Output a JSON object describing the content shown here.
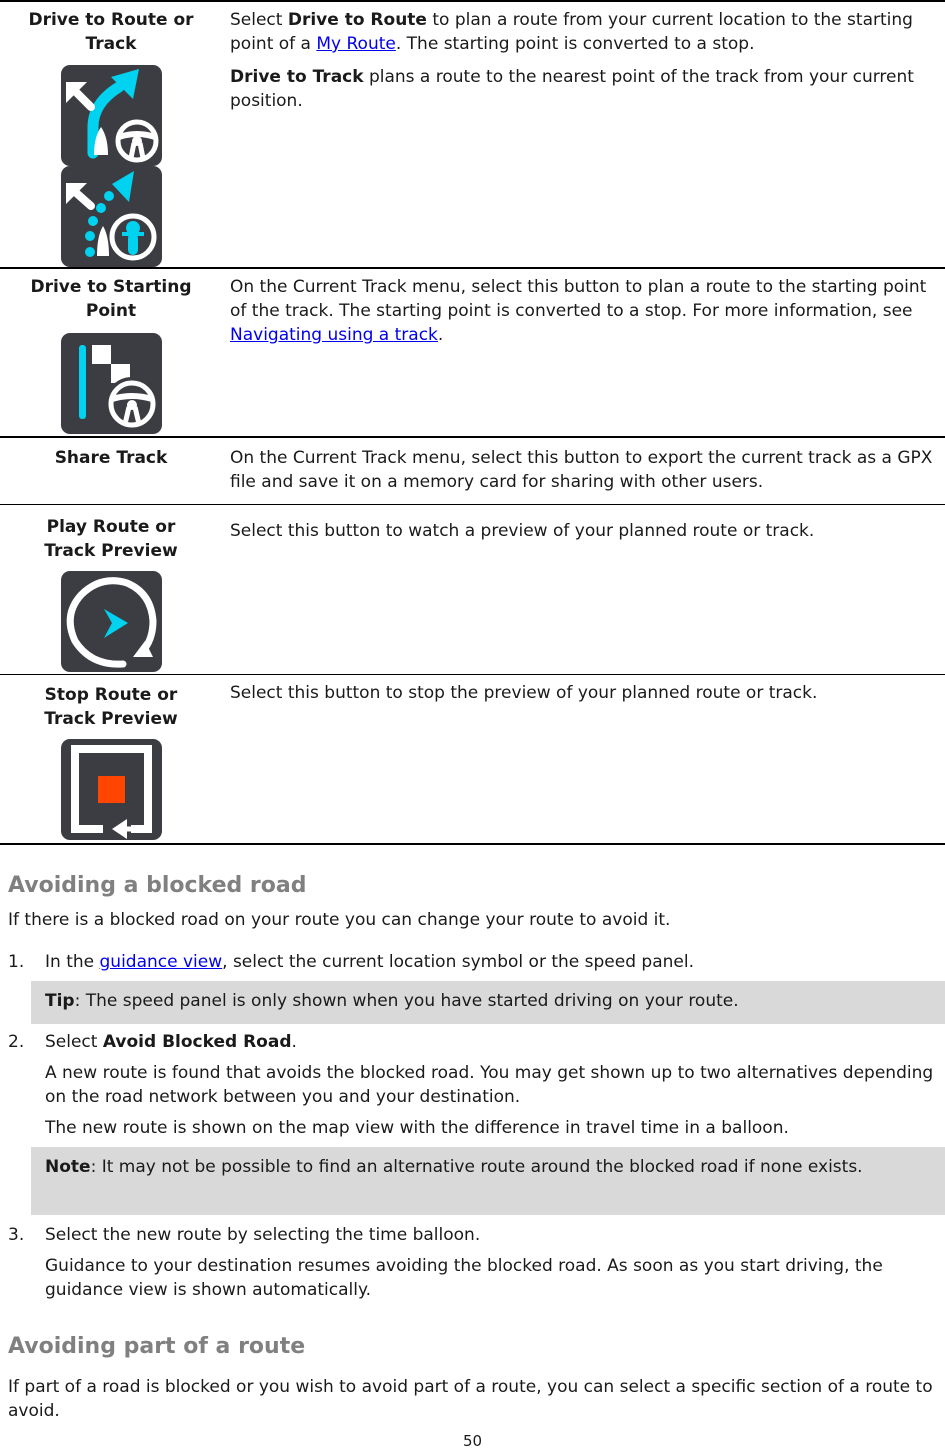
{
  "table": {
    "rows": [
      {
        "term": "Drive to Route or Track",
        "icons": [
          "drive-to-route-icon",
          "drive-to-track-icon"
        ],
        "desc1_pre": "Select ",
        "desc1_bold": "Drive to Route",
        "desc1_mid": " to plan a route from your current location to the starting point of a ",
        "desc1_link": "My Route",
        "desc1_post": ". The starting point is converted to a stop.",
        "desc2_bold": "Drive to Track",
        "desc2_post": " plans a route to the nearest point of the track from your current position."
      },
      {
        "term": "Drive to Starting Point",
        "icons": [
          "drive-to-starting-point-icon"
        ],
        "desc_pre": "On the Current Track menu, select this button to plan a route to the starting point of the track. The starting point is converted to a stop. For more information, see ",
        "desc_link": "Navigating using a track",
        "desc_post": "."
      },
      {
        "term": "Share Track",
        "icons": [],
        "desc": "On the Current Track menu, select this button to export the current track as a GPX file and save it on a memory card for sharing with other users."
      },
      {
        "term": "Play Route or Track Preview",
        "icons": [
          "play-preview-icon"
        ],
        "desc": "Select this button to watch a preview of your planned route or track."
      },
      {
        "term": "Stop Route or Track Preview",
        "icons": [
          "stop-preview-icon"
        ],
        "desc": "Select this button to stop the preview of your planned route or track."
      }
    ]
  },
  "section1": {
    "heading": "Avoiding a blocked road",
    "intro": "If there is a blocked road on your route you can change your route to avoid it.",
    "step1": {
      "num": "1.",
      "pre": "In the ",
      "link": "guidance view",
      "post": ", select the current location symbol or the speed panel."
    },
    "tip": {
      "label": "Tip",
      "text": ": The speed panel is only shown when you have started driving on your route."
    },
    "step2": {
      "num": "2.",
      "pre": "Select ",
      "bold": "Avoid Blocked Road",
      "post": ".",
      "p1": "A new route is found that avoids the blocked road. You may get shown up to two alternatives depending on the road network between you and your destination.",
      "p2": "The new route is shown on the map view with the difference in travel time in a balloon."
    },
    "note": {
      "label": "Note",
      "text": ": It may not be possible to find an alternative route around the blocked road if none exists."
    },
    "step3": {
      "num": "3.",
      "text": "Select the new route by selecting the time balloon.",
      "p1": "Guidance to your destination resumes avoiding the blocked road. As soon as you start driving, the guidance view is shown automatically."
    }
  },
  "section2": {
    "heading": "Avoiding part of a route",
    "intro": "If part of a road is blocked or you wish to avoid part of a route, you can select a specific section of a route to avoid."
  },
  "page_number": "50",
  "colors": {
    "icon_bg": "#3c3d42",
    "accent_cyan": "#00d2f0",
    "stop_red": "#ff4500",
    "link": "#0000ee",
    "heading": "#808080",
    "note_bg": "#d9d9d9"
  }
}
